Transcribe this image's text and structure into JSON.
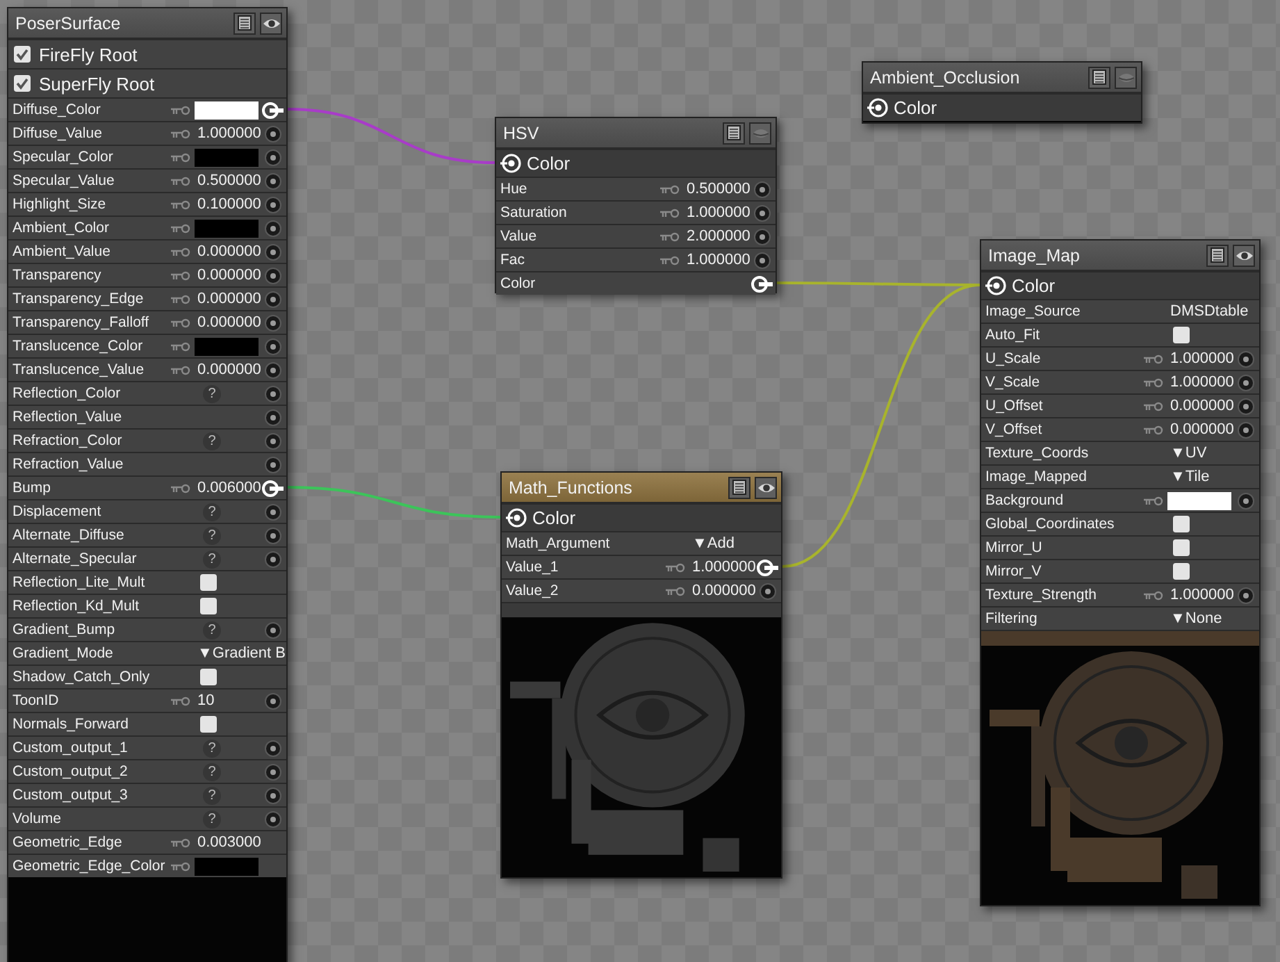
{
  "nodes": [
    {
      "title": "PoserSurface",
      "selected": false,
      "eye_open": true,
      "roots": [
        {
          "label": "FireFly Root",
          "checked": true
        },
        {
          "label": "SuperFly Root",
          "checked": true
        }
      ],
      "inputs": [
        {
          "label": "Diffuse_Color",
          "kind": "color",
          "color": "#ffffff",
          "socket": true,
          "connected": true
        },
        {
          "label": "Diffuse_Value",
          "kind": "value",
          "value": "1.000000",
          "socket": true,
          "connected": false
        },
        {
          "label": "Specular_Color",
          "kind": "color",
          "color": "#000000",
          "socket": true,
          "connected": false
        },
        {
          "label": "Specular_Value",
          "kind": "value",
          "value": "0.500000",
          "socket": true,
          "connected": false
        },
        {
          "label": "Highlight_Size",
          "kind": "value",
          "value": "0.100000",
          "socket": true,
          "connected": false
        },
        {
          "label": "Ambient_Color",
          "kind": "color",
          "color": "#000000",
          "socket": true,
          "connected": false
        },
        {
          "label": "Ambient_Value",
          "kind": "value",
          "value": "0.000000",
          "socket": true,
          "connected": false
        },
        {
          "label": "Transparency",
          "kind": "value",
          "value": "0.000000",
          "socket": true,
          "connected": false
        },
        {
          "label": "Transparency_Edge",
          "kind": "value",
          "value": "0.000000",
          "socket": true,
          "connected": false
        },
        {
          "label": "Transparency_Falloff",
          "kind": "value",
          "value": "0.000000",
          "socket": true,
          "connected": false
        },
        {
          "label": "Translucence_Color",
          "kind": "color",
          "color": "#000000",
          "socket": true,
          "connected": false
        },
        {
          "label": "Translucence_Value",
          "kind": "value",
          "value": "0.000000",
          "socket": true,
          "connected": false
        },
        {
          "label": "Reflection_Color",
          "kind": "unset",
          "value": "?",
          "socket": true,
          "connected": false
        },
        {
          "label": "Reflection_Value",
          "kind": "plain",
          "socket": true,
          "connected": false
        },
        {
          "label": "Refraction_Color",
          "kind": "unset",
          "value": "?",
          "socket": true,
          "connected": false
        },
        {
          "label": "Refraction_Value",
          "kind": "plain",
          "socket": true,
          "connected": false
        },
        {
          "label": "Bump",
          "kind": "value",
          "value": "0.006000",
          "socket": true,
          "connected": true
        },
        {
          "label": "Displacement",
          "kind": "unset",
          "value": "?",
          "socket": true,
          "connected": false
        },
        {
          "label": "Alternate_Diffuse",
          "kind": "unset",
          "value": "?",
          "socket": true,
          "connected": false
        },
        {
          "label": "Alternate_Specular",
          "kind": "unset",
          "value": "?",
          "socket": true,
          "connected": false
        },
        {
          "label": "Reflection_Lite_Mult",
          "kind": "checkbox",
          "checked": false,
          "socket": false
        },
        {
          "label": "Reflection_Kd_Mult",
          "kind": "checkbox",
          "checked": false,
          "socket": false
        },
        {
          "label": "Gradient_Bump",
          "kind": "unset",
          "value": "?",
          "socket": true,
          "connected": false
        },
        {
          "label": "Gradient_Mode",
          "kind": "menu",
          "value": "▼Gradient B",
          "socket": false
        },
        {
          "label": "Shadow_Catch_Only",
          "kind": "checkbox",
          "checked": false,
          "socket": false
        },
        {
          "label": "ToonID",
          "kind": "value",
          "value": "10",
          "socket": true,
          "connected": false
        },
        {
          "label": "Normals_Forward",
          "kind": "checkbox",
          "checked": false,
          "socket": false
        },
        {
          "label": "Custom_output_1",
          "kind": "unset",
          "value": "?",
          "socket": true,
          "connected": false
        },
        {
          "label": "Custom_output_2",
          "kind": "unset",
          "value": "?",
          "socket": true,
          "connected": false
        },
        {
          "label": "Custom_output_3",
          "kind": "unset",
          "value": "?",
          "socket": true,
          "connected": false
        },
        {
          "label": "Volume",
          "kind": "unset",
          "value": "?",
          "socket": true,
          "connected": false
        },
        {
          "label": "Geometric_Edge",
          "kind": "value",
          "value": "0.003000",
          "socket": false
        },
        {
          "label": "Geometric_Edge_Color",
          "kind": "color",
          "color": "#000000",
          "socket": false
        }
      ]
    },
    {
      "title": "HSV",
      "selected": false,
      "eye_open": false,
      "output": "Color",
      "inputs": [
        {
          "label": "Hue",
          "kind": "value",
          "value": "0.500000",
          "socket": true,
          "connected": false
        },
        {
          "label": "Saturation",
          "kind": "value",
          "value": "1.000000",
          "socket": true,
          "connected": false
        },
        {
          "label": "Value",
          "kind": "value",
          "value": "2.000000",
          "socket": true,
          "connected": false
        },
        {
          "label": "Fac",
          "kind": "value",
          "value": "1.000000",
          "socket": true,
          "connected": false
        },
        {
          "label": "Color",
          "kind": "plain",
          "socket": true,
          "connected": true
        }
      ]
    },
    {
      "title": "Ambient_Occlusion",
      "selected": false,
      "eye_open": false,
      "output": "Color"
    },
    {
      "title": "Image_Map",
      "selected": false,
      "eye_open": true,
      "output": "Color",
      "preview": {
        "kind": "picture"
      },
      "inputs": [
        {
          "label": "Image_Source",
          "kind": "text",
          "value": "DMSDtable",
          "socket": false
        },
        {
          "label": "Auto_Fit",
          "kind": "checkbox",
          "checked": false,
          "socket": false
        },
        {
          "label": "U_Scale",
          "kind": "value",
          "value": "1.000000",
          "socket": true,
          "connected": false
        },
        {
          "label": "V_Scale",
          "kind": "value",
          "value": "1.000000",
          "socket": true,
          "connected": false
        },
        {
          "label": "U_Offset",
          "kind": "value",
          "value": "0.000000",
          "socket": true,
          "connected": false
        },
        {
          "label": "V_Offset",
          "kind": "value",
          "value": "0.000000",
          "socket": true,
          "connected": false
        },
        {
          "label": "Texture_Coords",
          "kind": "menu",
          "value": "▼UV",
          "socket": false
        },
        {
          "label": "Image_Mapped",
          "kind": "menu",
          "value": "▼Tile",
          "socket": false
        },
        {
          "label": "Background",
          "kind": "color",
          "color": "#ffffff",
          "socket": true,
          "connected": false
        },
        {
          "label": "Global_Coordinates",
          "kind": "checkbox",
          "checked": false,
          "socket": false
        },
        {
          "label": "Mirror_U",
          "kind": "checkbox",
          "checked": false,
          "socket": false
        },
        {
          "label": "Mirror_V",
          "kind": "checkbox",
          "checked": false,
          "socket": false
        },
        {
          "label": "Texture_Strength",
          "kind": "value",
          "value": "1.000000",
          "socket": true,
          "connected": false
        },
        {
          "label": "Filtering",
          "kind": "menu",
          "value": "▼None",
          "socket": false
        }
      ]
    },
    {
      "title": "Math_Functions",
      "selected": true,
      "eye_open": true,
      "output": "Color",
      "preview": {
        "kind": "picture"
      },
      "inputs": [
        {
          "label": "Math_Argument",
          "kind": "menu",
          "value": "▼Add",
          "socket": false
        },
        {
          "label": "Value_1",
          "kind": "value",
          "value": "1.000000",
          "socket": true,
          "connected": true
        },
        {
          "label": "Value_2",
          "kind": "value",
          "value": "0.000000",
          "socket": true,
          "connected": false
        }
      ]
    }
  ],
  "wires": [
    {
      "color": "#a83cc8"
    },
    {
      "color": "#a8b42c"
    },
    {
      "color": "#a8b42c"
    },
    {
      "color": "#3cc45a"
    }
  ]
}
